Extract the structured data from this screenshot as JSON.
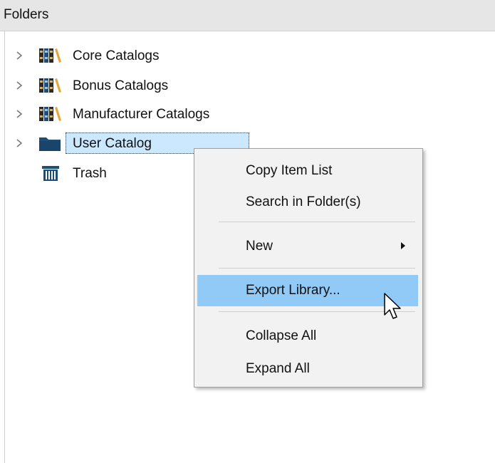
{
  "header": {
    "title": "Folders"
  },
  "tree": {
    "items": [
      {
        "label": "Core Catalogs",
        "icon": "books-icon",
        "expandable": true
      },
      {
        "label": "Bonus Catalogs",
        "icon": "books-icon",
        "expandable": true
      },
      {
        "label": "Manufacturer Catalogs",
        "icon": "books-icon",
        "expandable": true
      },
      {
        "label": "User Catalog",
        "icon": "folder-icon",
        "expandable": true,
        "selected": true
      },
      {
        "label": "Trash",
        "icon": "trash-icon",
        "expandable": false
      }
    ]
  },
  "context_menu": {
    "items": [
      {
        "label": "Copy Item List"
      },
      {
        "label": "Search in Folder(s)"
      },
      {
        "label": "New",
        "has_submenu": true
      },
      {
        "label": "Export Library...",
        "highlighted": true
      },
      {
        "label": "Collapse All"
      },
      {
        "label": "Expand All"
      }
    ]
  },
  "colors": {
    "header_bg": "#e6e6e6",
    "selection_bg": "#cce8ff",
    "menu_bg": "#f2f2f2",
    "menu_highlight": "#91c9f7",
    "folder_icon": "#1c4f78"
  }
}
